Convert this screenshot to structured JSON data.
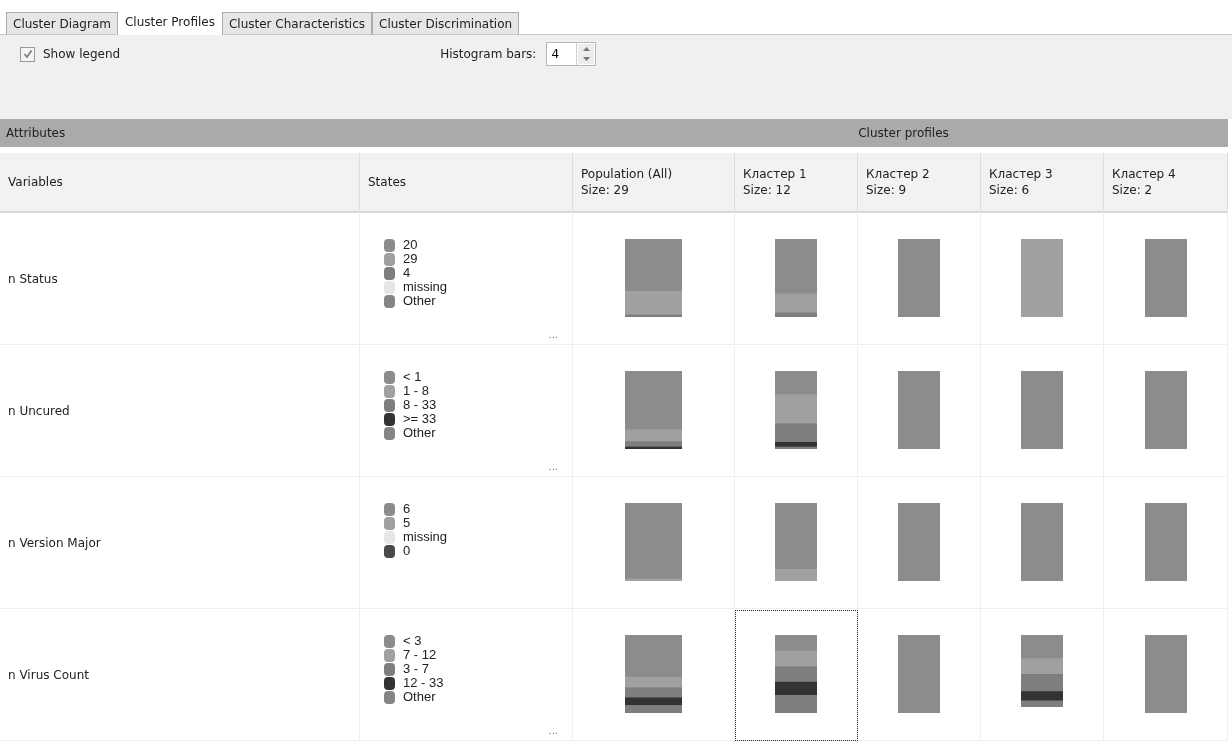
{
  "tabs": [
    {
      "label": "Cluster Diagram",
      "selected": false
    },
    {
      "label": "Cluster Profiles",
      "selected": true
    },
    {
      "label": "Cluster Characteristics",
      "selected": false
    },
    {
      "label": "Cluster Discrimination",
      "selected": false
    }
  ],
  "toolbar": {
    "show_legend": {
      "label": "Show legend",
      "checked": true
    },
    "histogram_bars": {
      "label": "Histogram bars:",
      "value": "4"
    }
  },
  "group_header": {
    "attributes": "Attributes",
    "profiles": "Cluster profiles"
  },
  "columns": {
    "variables": "Variables",
    "states": "States",
    "profiles": [
      {
        "title": "Population (All)",
        "size": "Size: 29"
      },
      {
        "title": "Кластер 1",
        "size": "Size: 12"
      },
      {
        "title": "Кластер 2",
        "size": "Size: 9"
      },
      {
        "title": "Кластер 3",
        "size": "Size: 6"
      },
      {
        "title": "Кластер 4",
        "size": "Size: 2"
      }
    ]
  },
  "rows": [
    {
      "variable": "n Status",
      "states": [
        {
          "label": "20",
          "color": "#8c8c8c"
        },
        {
          "label": "29",
          "color": "#a0a0a0"
        },
        {
          "label": "4",
          "color": "#7e7e7e"
        },
        {
          "label": "missing",
          "color": "#e6e6e6"
        },
        {
          "label": "Other",
          "color": "#858585"
        }
      ],
      "more": "...",
      "profiles": [
        {
          "selected": false
        },
        {
          "selected": false
        },
        {
          "selected": false
        },
        {
          "selected": false
        },
        {
          "selected": false
        }
      ]
    },
    {
      "variable": "n Uncured",
      "states": [
        {
          "label": "< 1",
          "color": "#8c8c8c"
        },
        {
          "label": "1 - 8",
          "color": "#a0a0a0"
        },
        {
          "label": "8 - 33",
          "color": "#7e7e7e"
        },
        {
          "label": ">= 33",
          "color": "#333333"
        },
        {
          "label": "Other",
          "color": "#858585"
        }
      ],
      "more": "...",
      "profiles": [
        {
          "selected": false
        },
        {
          "selected": false
        },
        {
          "selected": false
        },
        {
          "selected": false
        },
        {
          "selected": false
        }
      ]
    },
    {
      "variable": "n Version Major",
      "states": [
        {
          "label": "6",
          "color": "#8c8c8c"
        },
        {
          "label": "5",
          "color": "#a0a0a0"
        },
        {
          "label": "missing",
          "color": "#e6e6e6"
        },
        {
          "label": "0",
          "color": "#4a4a4a"
        }
      ],
      "profiles": [
        {
          "selected": false
        },
        {
          "selected": false
        },
        {
          "selected": false
        },
        {
          "selected": false
        },
        {
          "selected": false
        }
      ]
    },
    {
      "variable": "n Virus Count",
      "states": [
        {
          "label": "< 3",
          "color": "#8c8c8c"
        },
        {
          "label": "7 - 12",
          "color": "#a0a0a0"
        },
        {
          "label": "3 - 7",
          "color": "#7e7e7e"
        },
        {
          "label": "12 - 33",
          "color": "#333333"
        },
        {
          "label": "Other",
          "color": "#858585"
        }
      ],
      "more": "...",
      "profiles": [
        {
          "selected": false
        },
        {
          "selected": true
        },
        {
          "selected": false
        },
        {
          "selected": false
        },
        {
          "selected": false
        }
      ]
    }
  ]
}
